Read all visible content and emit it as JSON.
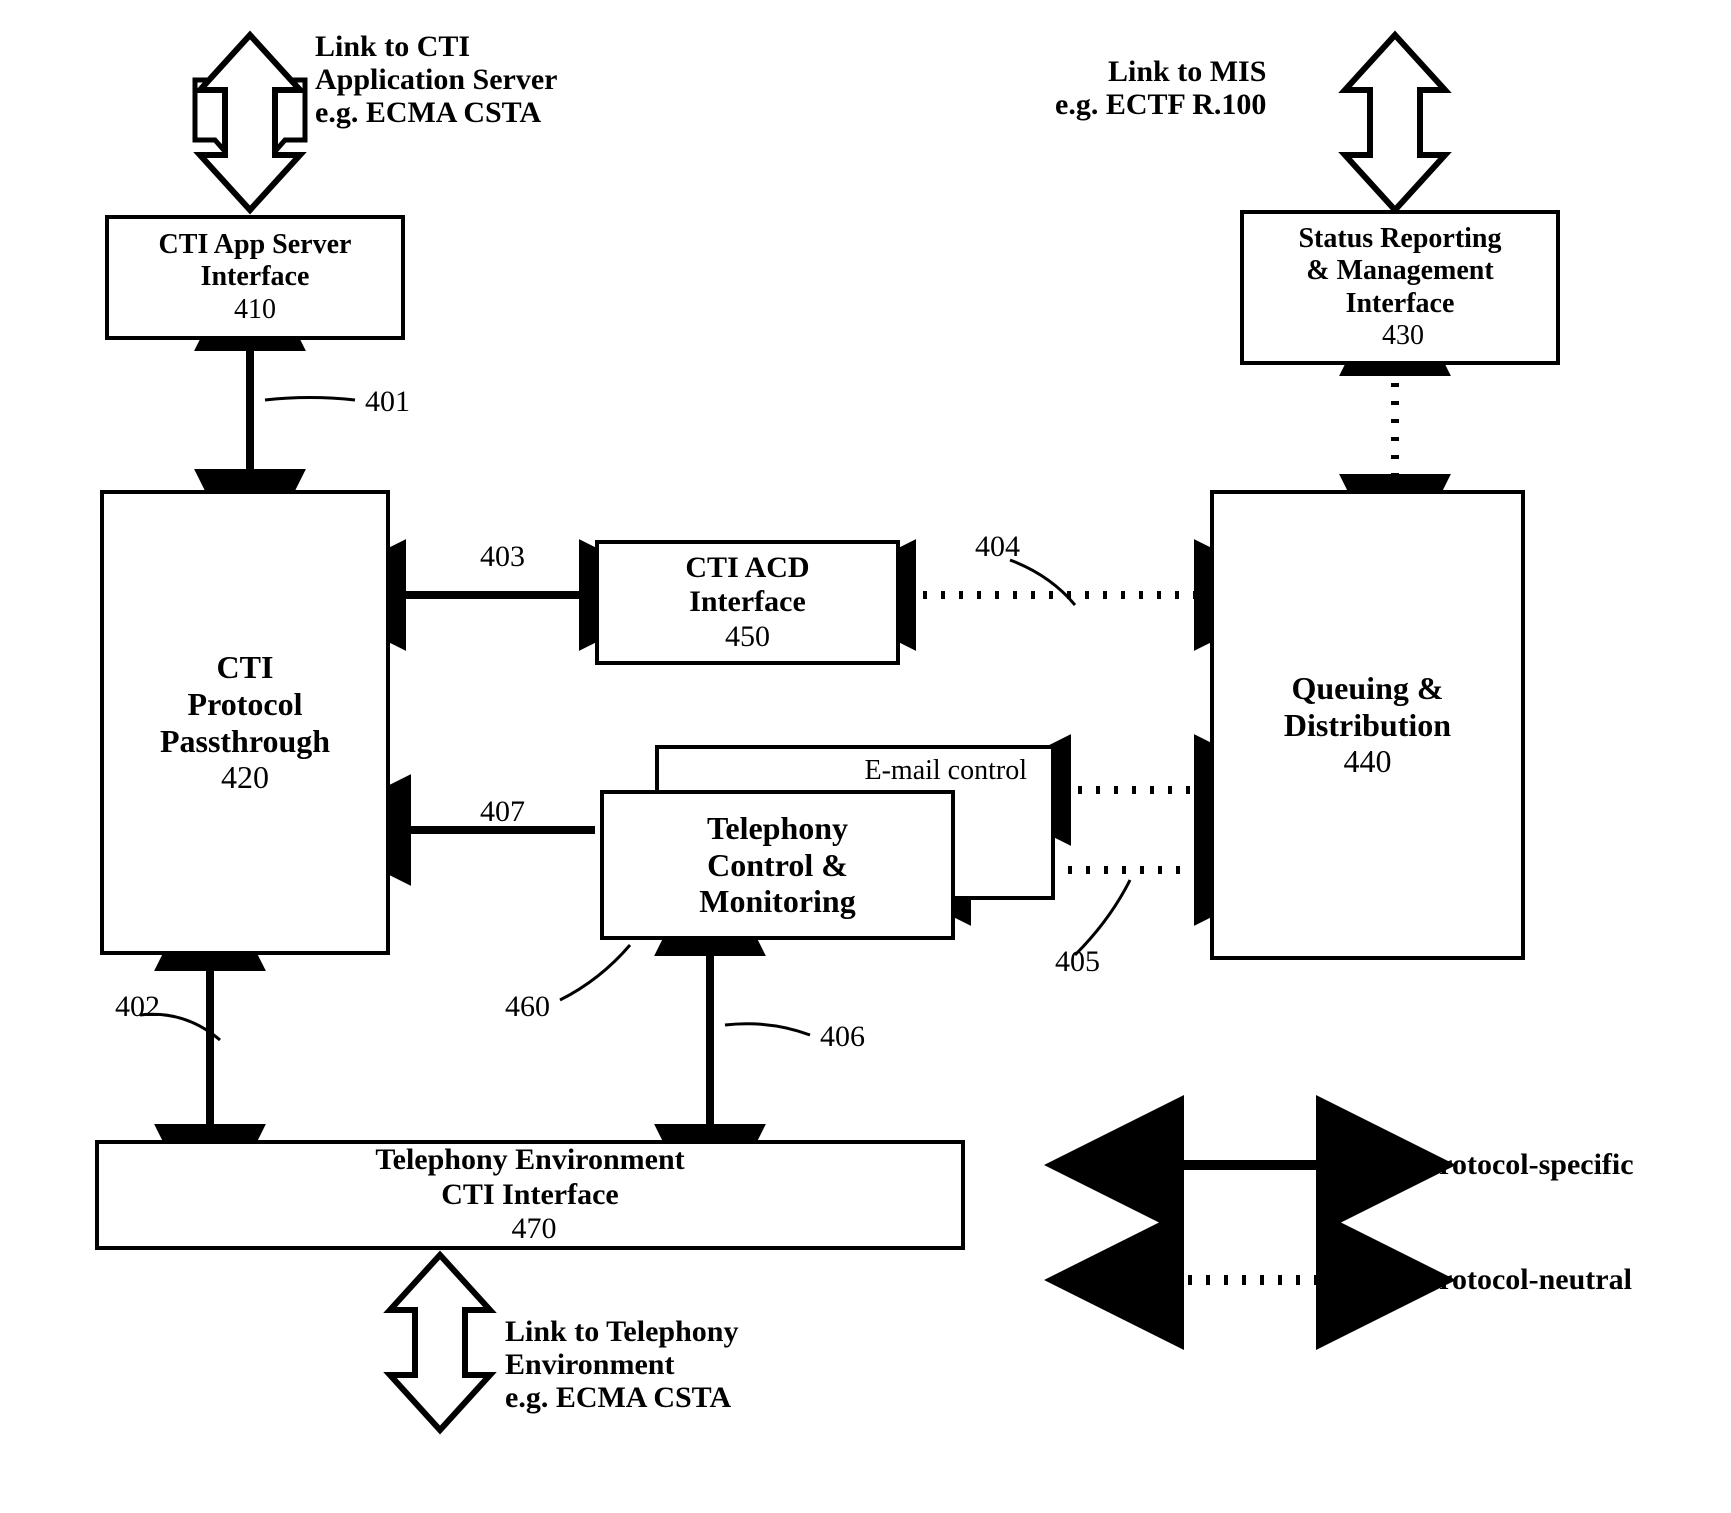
{
  "annotations": {
    "top_left": {
      "l1": "Link to CTI",
      "l2": "Application Server",
      "l3": "e.g. ECMA CSTA"
    },
    "top_right": {
      "l1": "Link to MIS",
      "l2": "e.g. ECTF R.100"
    },
    "bottom": {
      "l1": "Link to Telephony",
      "l2": "Environment",
      "l3": "e.g. ECMA CSTA"
    }
  },
  "boxes": {
    "cti_app_server": {
      "l1": "CTI App Server",
      "l2": "Interface",
      "num": "410"
    },
    "status_reporting": {
      "l1": "Status Reporting",
      "l2": "& Management",
      "l3": "Interface",
      "num": "430"
    },
    "cti_protocol": {
      "l1": "CTI",
      "l2": "Protocol",
      "l3": "Passthrough",
      "num": "420"
    },
    "cti_acd": {
      "l1": "CTI ACD",
      "l2": "Interface",
      "num": "450"
    },
    "queuing": {
      "l1": "Queuing &",
      "l2": "Distribution",
      "num": "440"
    },
    "email_control": {
      "l1": "E-mail control"
    },
    "tcm": {
      "l1": "Telephony",
      "l2": "Control &",
      "l3": "Monitoring"
    },
    "tcm_num": "460",
    "telephony_env": {
      "l1": "Telephony Environment",
      "l2": "CTI Interface",
      "num": "470"
    }
  },
  "edge_labels": {
    "401": "401",
    "402": "402",
    "403": "403",
    "404": "404",
    "405": "405",
    "406": "406",
    "407": "407"
  },
  "legend": {
    "solid": "CTI Protocol-specific",
    "dashed": "CTI Protocol-neutral"
  }
}
